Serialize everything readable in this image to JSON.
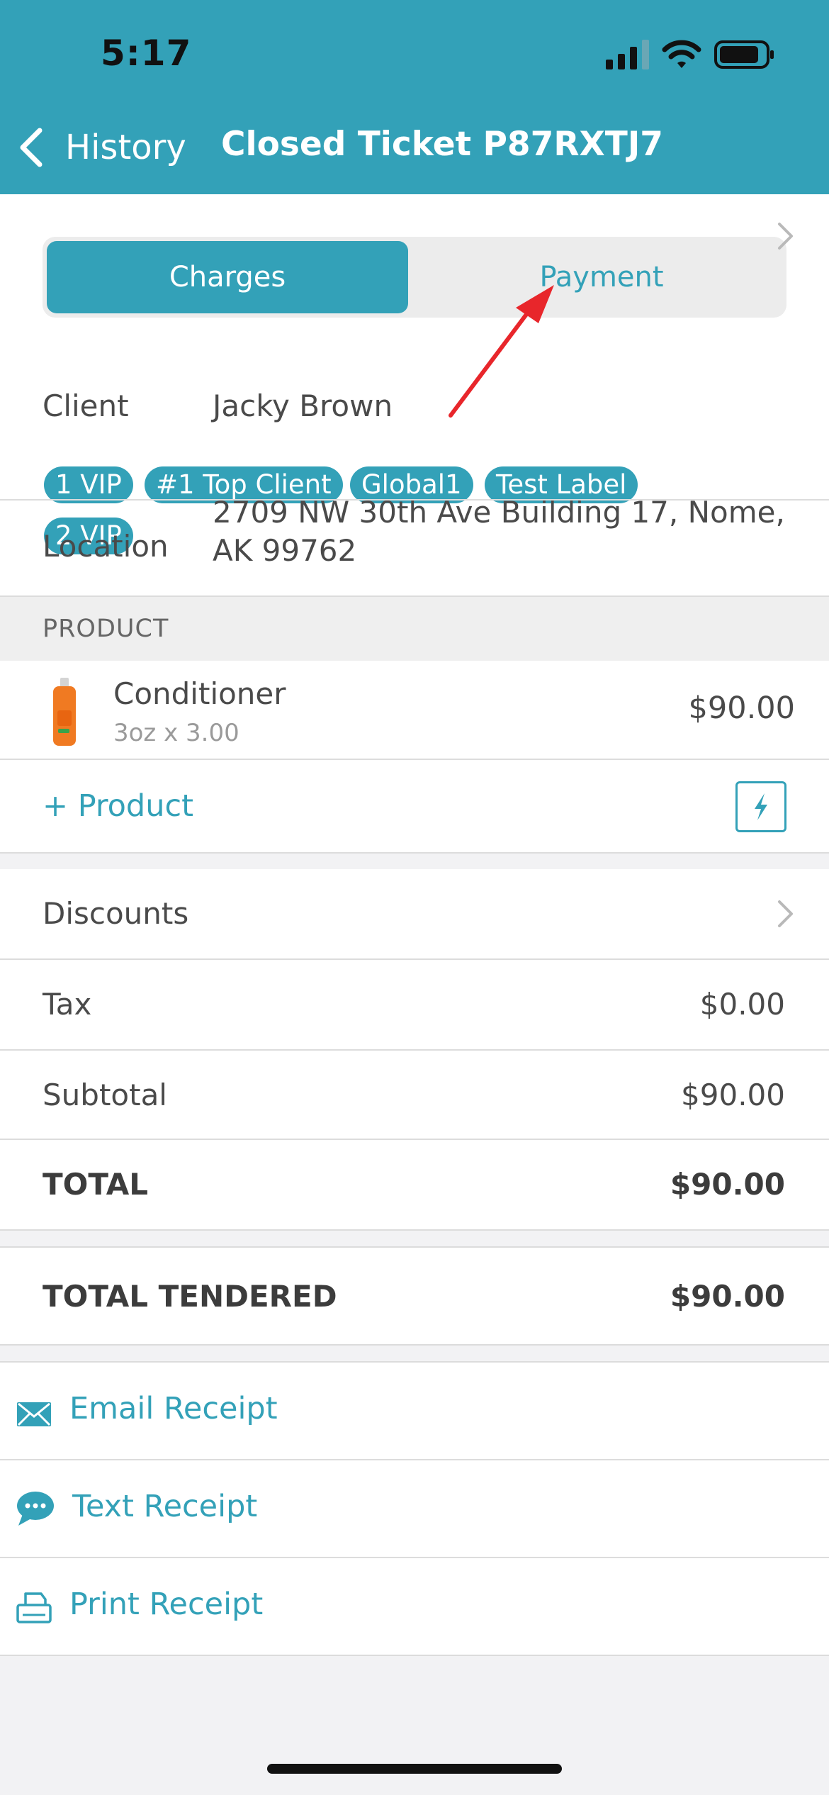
{
  "status_bar": {
    "time": "5:17"
  },
  "nav": {
    "back_label": "History",
    "title": "Closed Ticket P87RXTJ7"
  },
  "segments": {
    "charges": "Charges",
    "payment": "Payment",
    "selected": "Charges"
  },
  "client": {
    "label": "Client",
    "name": "Jacky Brown",
    "tags": [
      "1 VIP",
      "#1 Top Client",
      "Global1",
      "Test Label",
      "2 VIP"
    ]
  },
  "location": {
    "label": "Location",
    "line1": "2709 NW 30th Ave Building 17, Nome,",
    "line2": "AK 99762"
  },
  "product_section": {
    "header": "PRODUCT",
    "items": [
      {
        "name": "Conditioner",
        "detail": "3oz x 3.00",
        "price": "$90.00"
      }
    ],
    "add_label": "+ Product"
  },
  "summary": {
    "discounts": "Discounts",
    "tax_label": "Tax",
    "tax_value": "$0.00",
    "subtotal_label": "Subtotal",
    "subtotal_value": "$90.00",
    "total_label": "TOTAL",
    "total_value": "$90.00",
    "tendered_label": "TOTAL TENDERED",
    "tendered_value": "$90.00"
  },
  "receipts": {
    "email": "Email Receipt",
    "text": "Text Receipt",
    "print": "Print Receipt"
  },
  "colors": {
    "accent": "#33a1b8",
    "annotation": "#e8262b"
  }
}
